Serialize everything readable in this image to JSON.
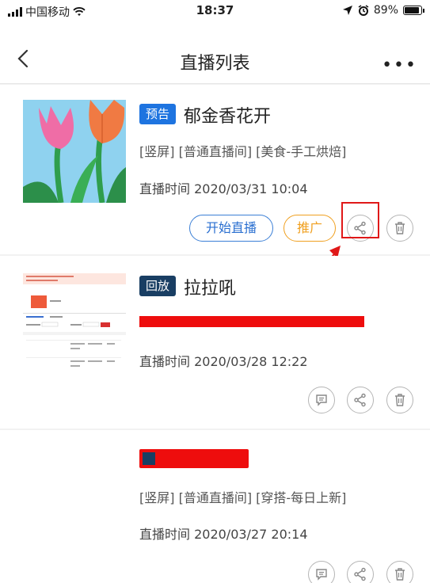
{
  "status_bar": {
    "carrier": "中国移动",
    "time": "18:37",
    "battery": "89%"
  },
  "nav": {
    "title": "直播列表",
    "more": "•••"
  },
  "items": [
    {
      "tag": "预告",
      "title": "郁金香花开",
      "categories": "[竖屏] [普通直播间] [美食-手工烘焙]",
      "time": "直播时间 2020/03/31  10:04",
      "buttons": {
        "start": "开始直播",
        "promote": "推广"
      }
    },
    {
      "tag": "回放",
      "title": "拉拉吼",
      "time": "直播时间 2020/03/28  12:22"
    },
    {
      "categories": "[竖屏] [普通直播间] [穿搭-每日上新]",
      "time": "直播时间 2020/03/27  20:14"
    }
  ],
  "colors": {
    "accent_blue": "#1e74e0",
    "tag_dark": "#193e63",
    "promote_orange": "#f0a020",
    "annotation_red": "#e01818"
  },
  "icons": {
    "back": "chevron-left-icon",
    "more": "more-dots-icon",
    "share": "share-icon",
    "delete": "trash-icon",
    "comment": "message-icon"
  }
}
